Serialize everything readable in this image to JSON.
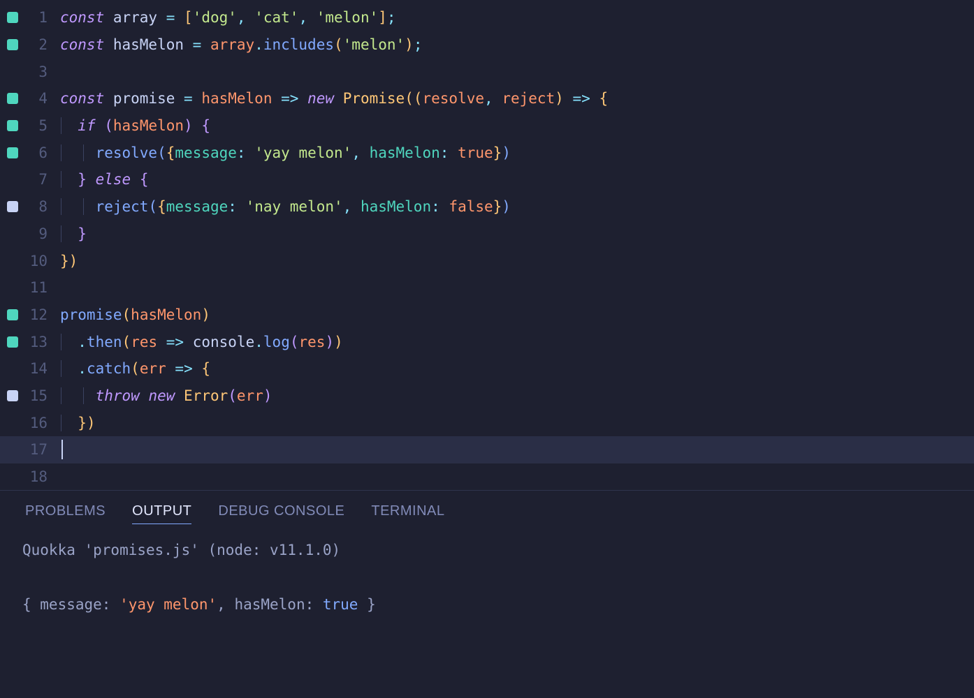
{
  "editor": {
    "lines": [
      {
        "n": 1,
        "marker": "green",
        "tokens": [
          [
            "kw",
            "const"
          ],
          [
            "",
            ""
          ],
          [
            "var",
            " array "
          ],
          [
            "op",
            "="
          ],
          [
            "",
            " "
          ],
          [
            "par1",
            "["
          ],
          [
            "str",
            "'dog'"
          ],
          [
            "pn",
            ", "
          ],
          [
            "str",
            "'cat'"
          ],
          [
            "pn",
            ", "
          ],
          [
            "str",
            "'melon'"
          ],
          [
            "par1",
            "]"
          ],
          [
            "pn",
            ";"
          ]
        ]
      },
      {
        "n": 2,
        "marker": "green",
        "tokens": [
          [
            "kw",
            "const"
          ],
          [
            "var",
            " hasMelon "
          ],
          [
            "op",
            "="
          ],
          [
            "",
            " "
          ],
          [
            "varC",
            "array"
          ],
          [
            "op",
            "."
          ],
          [
            "fn",
            "includes"
          ],
          [
            "par1",
            "("
          ],
          [
            "str",
            "'melon'"
          ],
          [
            "par1",
            ")"
          ],
          [
            "pn",
            ";"
          ]
        ]
      },
      {
        "n": 3,
        "marker": null,
        "tokens": []
      },
      {
        "n": 4,
        "marker": "green",
        "tokens": [
          [
            "kw",
            "const"
          ],
          [
            "var",
            " promise "
          ],
          [
            "op",
            "="
          ],
          [
            "",
            " "
          ],
          [
            "varC",
            "hasMelon"
          ],
          [
            "",
            " "
          ],
          [
            "op",
            "=>"
          ],
          [
            "",
            " "
          ],
          [
            "kw",
            "new"
          ],
          [
            "",
            " "
          ],
          [
            "cls",
            "Promise"
          ],
          [
            "par1",
            "(("
          ],
          [
            "varC",
            "resolve"
          ],
          [
            "pn",
            ", "
          ],
          [
            "varC",
            "reject"
          ],
          [
            "par1",
            ")"
          ],
          [
            "",
            " "
          ],
          [
            "op",
            "=>"
          ],
          [
            "",
            " "
          ],
          [
            "par1",
            "{"
          ]
        ]
      },
      {
        "n": 5,
        "marker": "green",
        "indent": 1,
        "tokens": [
          [
            "",
            "  "
          ],
          [
            "kw",
            "if"
          ],
          [
            "",
            " "
          ],
          [
            "par2",
            "("
          ],
          [
            "varC",
            "hasMelon"
          ],
          [
            "par2",
            ")"
          ],
          [
            "",
            " "
          ],
          [
            "par2",
            "{"
          ]
        ]
      },
      {
        "n": 6,
        "marker": "green",
        "indent": 2,
        "tokens": [
          [
            "",
            "    "
          ],
          [
            "fn",
            "resolve"
          ],
          [
            "par3",
            "("
          ],
          [
            "par1",
            "{"
          ],
          [
            "prop",
            "message"
          ],
          [
            "op",
            ":"
          ],
          [
            "",
            " "
          ],
          [
            "str",
            "'yay melon'"
          ],
          [
            "pn",
            ", "
          ],
          [
            "prop",
            "hasMelon"
          ],
          [
            "op",
            ":"
          ],
          [
            "",
            " "
          ],
          [
            "bool",
            "true"
          ],
          [
            "par1",
            "}"
          ],
          [
            "par3",
            ")"
          ]
        ]
      },
      {
        "n": 7,
        "marker": null,
        "indent": 1,
        "tokens": [
          [
            "",
            "  "
          ],
          [
            "par2",
            "}"
          ],
          [
            "",
            " "
          ],
          [
            "kw",
            "else"
          ],
          [
            "",
            " "
          ],
          [
            "par2",
            "{"
          ]
        ]
      },
      {
        "n": 8,
        "marker": "gray",
        "indent": 2,
        "tokens": [
          [
            "",
            "    "
          ],
          [
            "fn",
            "reject"
          ],
          [
            "par3",
            "("
          ],
          [
            "par1",
            "{"
          ],
          [
            "prop",
            "message"
          ],
          [
            "op",
            ":"
          ],
          [
            "",
            " "
          ],
          [
            "str",
            "'nay melon'"
          ],
          [
            "pn",
            ", "
          ],
          [
            "prop",
            "hasMelon"
          ],
          [
            "op",
            ":"
          ],
          [
            "",
            " "
          ],
          [
            "bool",
            "false"
          ],
          [
            "par1",
            "}"
          ],
          [
            "par3",
            ")"
          ]
        ]
      },
      {
        "n": 9,
        "marker": null,
        "indent": 1,
        "tokens": [
          [
            "",
            "  "
          ],
          [
            "par2",
            "}"
          ]
        ]
      },
      {
        "n": 10,
        "marker": null,
        "tokens": [
          [
            "par1",
            "})"
          ]
        ]
      },
      {
        "n": 11,
        "marker": null,
        "tokens": []
      },
      {
        "n": 12,
        "marker": "green",
        "tokens": [
          [
            "fn",
            "promise"
          ],
          [
            "par1",
            "("
          ],
          [
            "varC",
            "hasMelon"
          ],
          [
            "par1",
            ")"
          ]
        ]
      },
      {
        "n": 13,
        "marker": "green",
        "indent": 1,
        "tokens": [
          [
            "",
            "  "
          ],
          [
            "op",
            "."
          ],
          [
            "fn",
            "then"
          ],
          [
            "par1",
            "("
          ],
          [
            "varC",
            "res"
          ],
          [
            "",
            " "
          ],
          [
            "op",
            "=>"
          ],
          [
            "",
            " "
          ],
          [
            "var",
            "console"
          ],
          [
            "op",
            "."
          ],
          [
            "fn",
            "log"
          ],
          [
            "par2",
            "("
          ],
          [
            "varC",
            "res"
          ],
          [
            "par2",
            ")"
          ],
          [
            "par1",
            ")"
          ]
        ]
      },
      {
        "n": 14,
        "marker": null,
        "indent": 1,
        "tokens": [
          [
            "",
            "  "
          ],
          [
            "op",
            "."
          ],
          [
            "fn",
            "catch"
          ],
          [
            "par1",
            "("
          ],
          [
            "varC",
            "err"
          ],
          [
            "",
            " "
          ],
          [
            "op",
            "=>"
          ],
          [
            "",
            " "
          ],
          [
            "par1",
            "{"
          ]
        ]
      },
      {
        "n": 15,
        "marker": "gray",
        "indent": 2,
        "tokens": [
          [
            "",
            "    "
          ],
          [
            "kw",
            "throw"
          ],
          [
            "",
            " "
          ],
          [
            "kw",
            "new"
          ],
          [
            "",
            " "
          ],
          [
            "cls",
            "Error"
          ],
          [
            "par2",
            "("
          ],
          [
            "varC",
            "err"
          ],
          [
            "par2",
            ")"
          ]
        ]
      },
      {
        "n": 16,
        "marker": null,
        "indent": 1,
        "tokens": [
          [
            "",
            "  "
          ],
          [
            "par1",
            "})"
          ]
        ]
      },
      {
        "n": 17,
        "marker": null,
        "current": true,
        "cursor": true,
        "tokens": []
      },
      {
        "n": 18,
        "marker": null,
        "tokens": []
      }
    ]
  },
  "panel": {
    "tabs": {
      "problems": "PROBLEMS",
      "output": "OUTPUT",
      "debug": "DEBUG CONSOLE",
      "terminal": "TERMINAL"
    },
    "active_tab": "output",
    "output_lines": [
      {
        "plain": "Quokka 'promises.js' (node: v11.1.0)"
      },
      {
        "plain": ""
      },
      {
        "rich": [
          [
            "",
            "{ message: "
          ],
          [
            "str",
            "'yay melon'"
          ],
          [
            "",
            ", hasMelon: "
          ],
          [
            "bool",
            "true"
          ],
          [
            "",
            " }"
          ]
        ]
      }
    ]
  }
}
